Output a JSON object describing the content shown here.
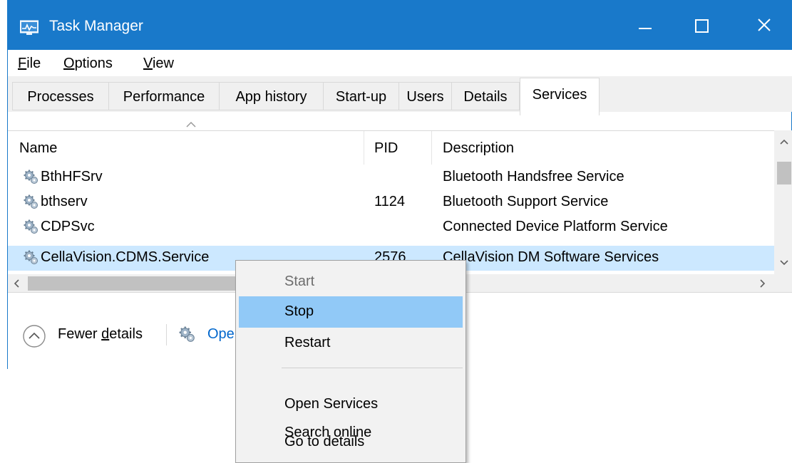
{
  "window": {
    "title": "Task Manager"
  },
  "menu": {
    "file": "File",
    "options": "Options",
    "view": "View"
  },
  "tabs": [
    {
      "label": "Processes"
    },
    {
      "label": "Performance"
    },
    {
      "label": "App history"
    },
    {
      "label": "Start-up"
    },
    {
      "label": "Users"
    },
    {
      "label": "Details"
    },
    {
      "label": "Services",
      "active": true
    }
  ],
  "table": {
    "columns": {
      "name": "Name",
      "pid": "PID",
      "description": "Description"
    },
    "rows": [
      {
        "name": "BthHFSrv",
        "pid": "",
        "description": "Bluetooth Handsfree Service"
      },
      {
        "name": "bthserv",
        "pid": "1124",
        "description": "Bluetooth Support Service"
      },
      {
        "name": "CDPSvc",
        "pid": "",
        "description": "Connected Device Platform Service"
      },
      {
        "name": "CellaVision.CDMS.Service",
        "pid": "2576",
        "description": "CellaVision DM Software Services",
        "selected": true
      }
    ]
  },
  "footer": {
    "fewer_details_prefix": "Fewer ",
    "fewer_details_underlined": "d",
    "fewer_details_suffix": "etails",
    "open_services": "Open Services"
  },
  "context_menu": {
    "items": [
      {
        "label": "Start",
        "disabled": true
      },
      {
        "label": "Stop",
        "highlighted": true
      },
      {
        "label": "Restart"
      },
      {
        "label": "Open Services"
      },
      {
        "label": "Search online"
      },
      {
        "label": "Go to details"
      }
    ]
  },
  "icons": {
    "app": "task-manager-icon",
    "service": "gear-icon"
  },
  "colors": {
    "titlebar": "#1979ca",
    "selected_row": "#cce8ff",
    "menu_highlight": "#91c9f7",
    "link": "#0066cc"
  }
}
